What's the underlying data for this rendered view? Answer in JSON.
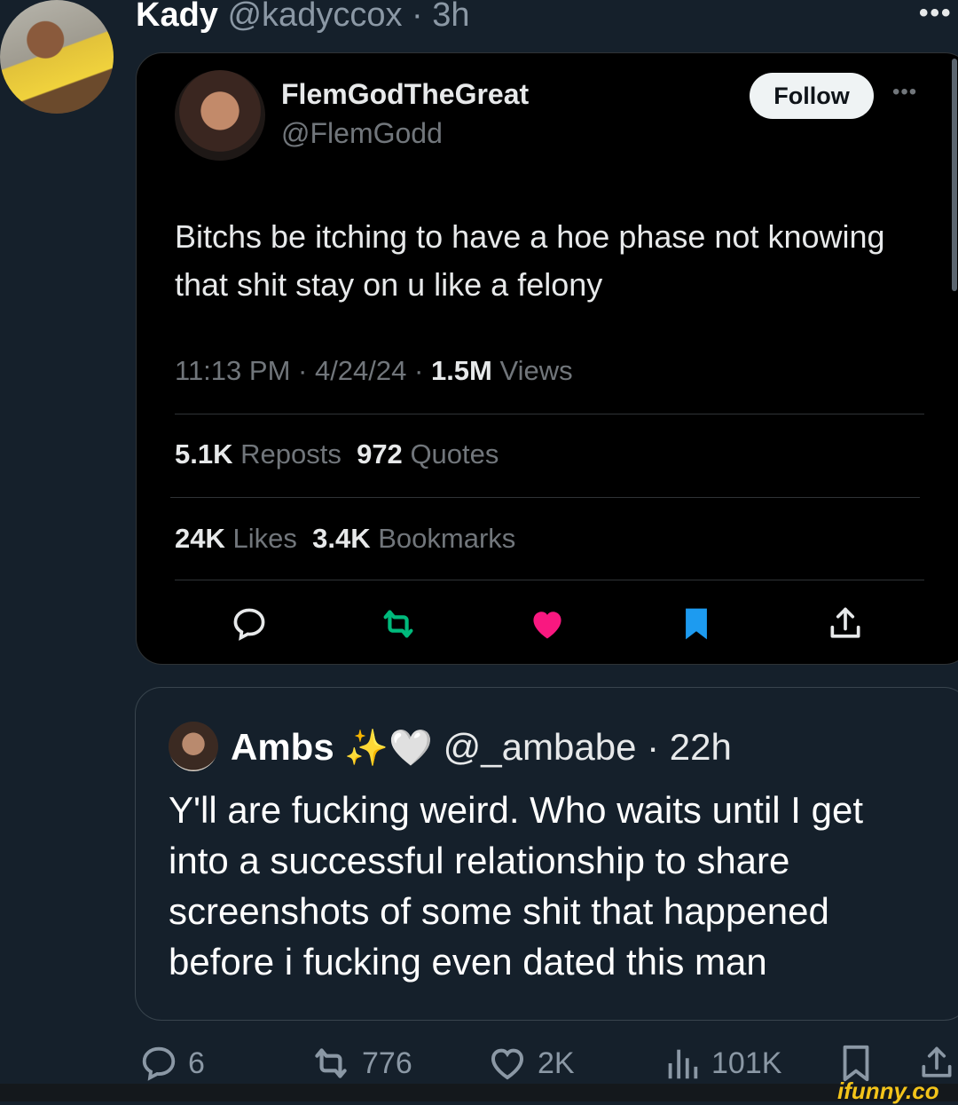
{
  "post": {
    "author_name": "Kady",
    "author_handle": "@kadyccox",
    "time": "3h",
    "more": "•••"
  },
  "quoted": {
    "name": "FlemGodTheGreat",
    "handle": "@FlemGodd",
    "follow_label": "Follow",
    "more": "•••",
    "text": "Bitchs be itching to have a hoe phase not knowing that shit stay on u like a felony",
    "time": "11:13 PM",
    "date": "4/24/24",
    "views_count": "1.5M",
    "views_label": "Views",
    "reposts_count": "5.1K",
    "reposts_label": "Reposts",
    "quotes_count": "972",
    "quotes_label": "Quotes",
    "likes_count": "24K",
    "likes_label": "Likes",
    "bookmarks_count": "3.4K",
    "bookmarks_label": "Bookmarks"
  },
  "reply": {
    "name": "Ambs",
    "emojis": "✨🤍",
    "handle": "@_ambabe",
    "time": "22h",
    "text": "Y'll are fucking weird. Who waits until I get into a successful relationship to share screenshots of some shit that happened before i fucking even dated this man"
  },
  "actions": {
    "replies": "6",
    "reposts": "776",
    "likes": "2K",
    "views": "101K"
  },
  "watermark": "ifunny.co",
  "colors": {
    "background": "#15202b",
    "card_black": "#000000",
    "repost_green": "#00ba7c",
    "like_pink": "#f91880",
    "bookmark_blue": "#1d9bf0"
  }
}
